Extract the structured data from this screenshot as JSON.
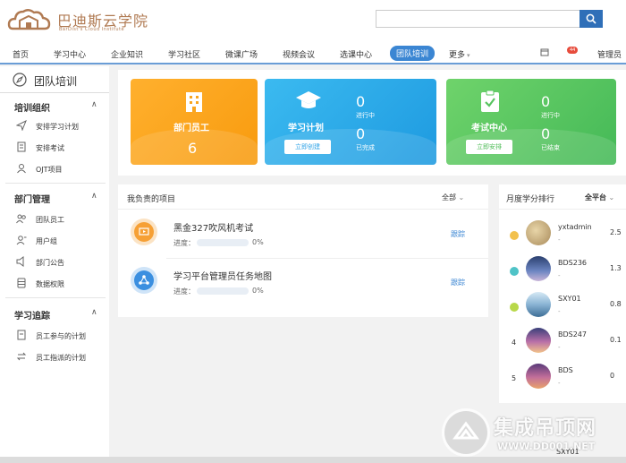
{
  "header": {
    "logo_title": "巴迪斯云学院",
    "logo_subtitle": "BarDist's Cloud Institute",
    "search_placeholder": ""
  },
  "nav": {
    "items": [
      "首页",
      "学习中心",
      "企业知识",
      "学习社区",
      "微课广场",
      "视频会议",
      "选课中心",
      "团队培训",
      "更多"
    ],
    "active": "团队培训",
    "badge": "44",
    "user": "管理员"
  },
  "sidebar": {
    "title": "团队培训",
    "sections": [
      {
        "title": "培训组织",
        "items": [
          "安排学习计划",
          "安排考试",
          "OJT项目"
        ]
      },
      {
        "title": "部门管理",
        "items": [
          "团队员工",
          "用户组",
          "部门公告",
          "数据权限"
        ]
      },
      {
        "title": "学习追踪",
        "items": [
          "员工参与的计划",
          "员工指派的计划"
        ]
      }
    ]
  },
  "cards": {
    "staff": {
      "label": "部门员工",
      "count": "6"
    },
    "plan": {
      "label": "学习计划",
      "button": "立即创建",
      "in_progress": "0",
      "in_progress_label": "进行中",
      "done": "0",
      "done_label": "已完成"
    },
    "exam": {
      "label": "考试中心",
      "button": "立即安排",
      "in_progress": "0",
      "in_progress_label": "进行中",
      "done": "0",
      "done_label": "已结束"
    }
  },
  "projects": {
    "title": "我负责的项目",
    "filter": "全部",
    "progress_label": "进度：",
    "track_label": "跟踪",
    "rows": [
      {
        "name": "黑金327吹风机考试",
        "progress": "0%",
        "progress_value": 0
      },
      {
        "name": "学习平台管理员任务地图",
        "progress": "0%",
        "progress_value": 0
      }
    ]
  },
  "ranking": {
    "title": "月度学分排行",
    "filter": "全平台",
    "rows": [
      {
        "rank": "1",
        "name": "yxtadmin",
        "sub": "-",
        "score": "2.5"
      },
      {
        "rank": "2",
        "name": "BDS236",
        "sub": "-",
        "score": "1.3"
      },
      {
        "rank": "3",
        "name": "SXY01",
        "sub": "-",
        "score": "0.8"
      },
      {
        "rank": "4",
        "name": "BDS247",
        "sub": "-",
        "score": "0.1"
      },
      {
        "rank": "5",
        "name": "BDS",
        "sub": "-",
        "score": "0"
      }
    ],
    "partial_name": "SXY01"
  },
  "watermark": {
    "title": "集成吊顶网",
    "url": "WWW.DD001.NET"
  },
  "colors": {
    "primary": "#3b86d3",
    "orange": "#f9a51e",
    "blue": "#29a8e8",
    "green": "#58c45f",
    "brand": "#b07a52"
  }
}
